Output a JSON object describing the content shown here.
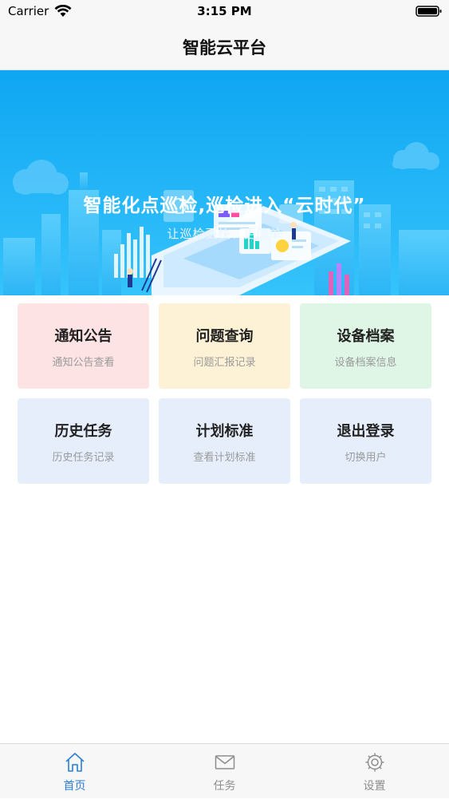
{
  "status_bar": {
    "carrier": "Carrier",
    "time": "3:15 PM"
  },
  "nav": {
    "title": "智能云平台"
  },
  "banner": {
    "headline": "智能化点巡检,巡检进入“云时代”",
    "tagline": "让巡检更快、更简单"
  },
  "menu": [
    {
      "title": "通知公告",
      "subtitle": "通知公告查看",
      "color": "#fde3e4"
    },
    {
      "title": "问题查询",
      "subtitle": "问题汇报记录",
      "color": "#fdf2d6"
    },
    {
      "title": "设备档案",
      "subtitle": "设备档案信息",
      "color": "#dff5e6"
    },
    {
      "title": "历史任务",
      "subtitle": "历史任务记录",
      "color": "#e6eefc"
    },
    {
      "title": "计划标准",
      "subtitle": "查看计划标准",
      "color": "#e6eefc"
    },
    {
      "title": "退出登录",
      "subtitle": "切换用户",
      "color": "#e6eefc"
    }
  ],
  "tabbar": {
    "tabs": [
      {
        "label": "首页",
        "icon": "home-icon",
        "active": true
      },
      {
        "label": "任务",
        "icon": "mail-icon",
        "active": false
      },
      {
        "label": "设置",
        "icon": "gear-icon",
        "active": false
      }
    ],
    "active_color": "#2a7fd4",
    "inactive_color": "#8e8e8e"
  }
}
